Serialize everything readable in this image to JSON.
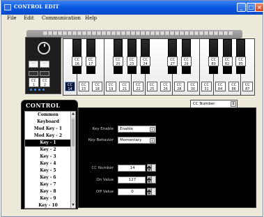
{
  "window": {
    "title": "CONTROL EDIT"
  },
  "menu": [
    "File",
    "Edit",
    "Communication",
    "Help"
  ],
  "keyboard": {
    "left_buttons": [
      "CC\n1",
      "CC\n2"
    ],
    "black_cc": [
      "CC\n16",
      "CC\n17",
      "CC\n20",
      "CC\n23",
      "CC\n24",
      "CC\n27",
      "CC\n29",
      "CC\n80",
      "CC\n82",
      "CC\n85"
    ],
    "white_cc": [
      "CC\n14",
      "CC\n15",
      "CC\n18",
      "CC\n19",
      "CC\n21",
      "CC\n22",
      "CC\n25",
      "CC\n26",
      "CC\n28",
      "CC\n30",
      "CC\n31",
      "CC\n84",
      "CC\n86",
      "CC\n87"
    ]
  },
  "control": {
    "title": "CONTROL",
    "items": [
      "Common",
      "Keyboard",
      "Mod Key - 1",
      "Mod Key - 2",
      "Key - 1",
      "Key - 2",
      "Key - 3",
      "Key - 4",
      "Key - 5",
      "Key - 6",
      "Key - 7",
      "Key - 8",
      "Key - 9",
      "Key - 10"
    ],
    "selected_index": 4
  },
  "mode_select": {
    "value": "CC Number"
  },
  "settings": {
    "key_enable_label": "Key Enable",
    "key_enable_value": "Enable",
    "key_behavior_label": "Key Behavior",
    "key_behavior_value": "Momentary",
    "cc_number_label": "CC Number",
    "cc_number_value": "14",
    "on_value_label": "On Value",
    "on_value_value": "127",
    "off_value_label": "Off Value",
    "off_value_value": "0"
  }
}
